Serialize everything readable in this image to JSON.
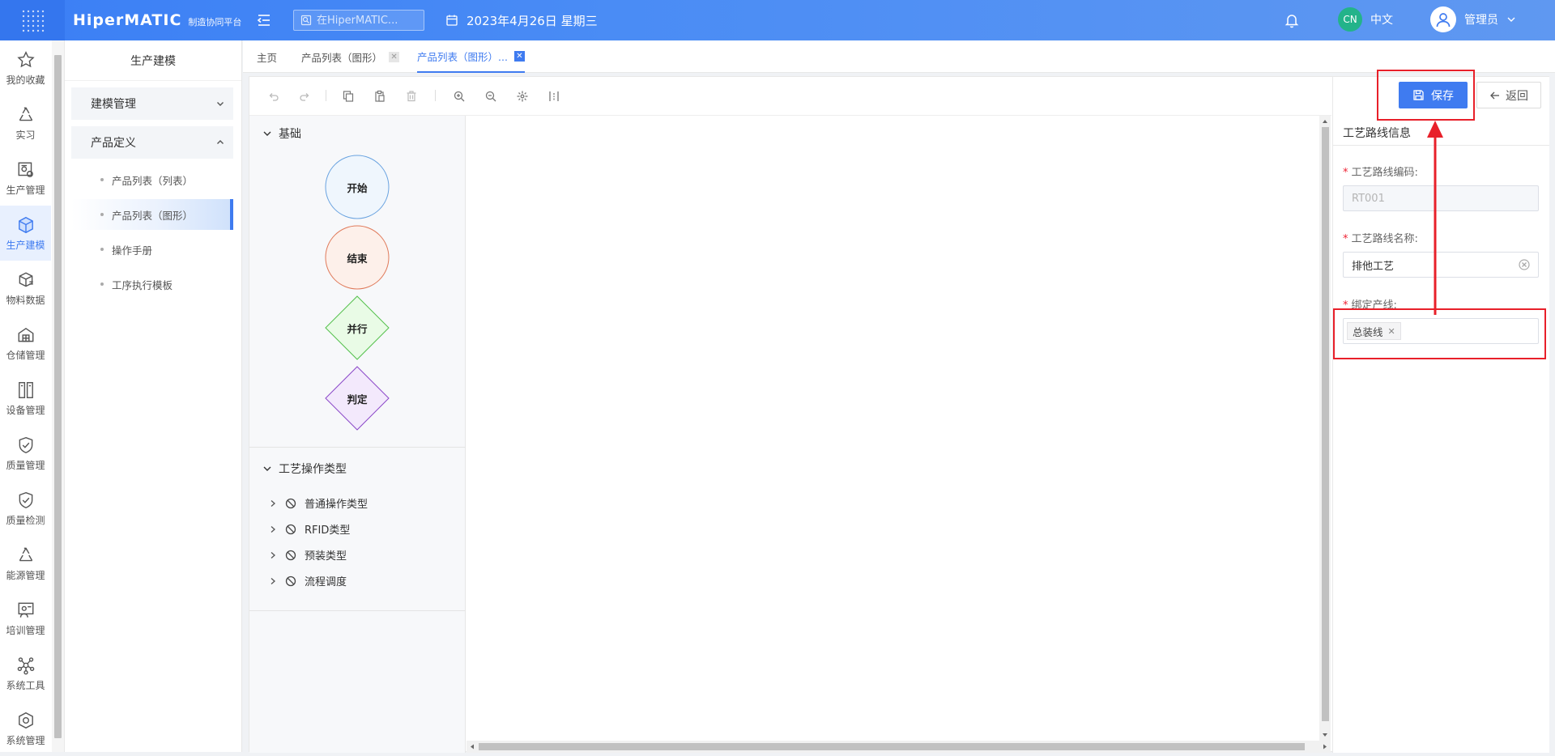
{
  "header": {
    "logo_main": "HiperMATIC",
    "logo_sub": "制造协同平台",
    "search_placeholder": "在HiperMATIC...",
    "date_text": "2023年4月26日 星期三",
    "lang_badge": "CN",
    "lang_label": "中文",
    "user_name": "管理员"
  },
  "rail": {
    "items": [
      {
        "label": "我的收藏",
        "icon": "star-icon"
      },
      {
        "label": "实习",
        "icon": "recycle-icon"
      },
      {
        "label": "生产管理",
        "icon": "production-icon"
      },
      {
        "label": "生产建模",
        "icon": "cube-icon"
      },
      {
        "label": "物料数据",
        "icon": "box-icon"
      },
      {
        "label": "仓储管理",
        "icon": "warehouse-icon"
      },
      {
        "label": "设备管理",
        "icon": "device-icon"
      },
      {
        "label": "质量管理",
        "icon": "shield-check-icon"
      },
      {
        "label": "质量检测",
        "icon": "shield-check-icon"
      },
      {
        "label": "能源管理",
        "icon": "recycle-icon"
      },
      {
        "label": "培训管理",
        "icon": "training-icon"
      },
      {
        "label": "系统工具",
        "icon": "network-icon"
      },
      {
        "label": "系统管理",
        "icon": "settings-cube-icon"
      }
    ],
    "active_index": 3
  },
  "submenu": {
    "title": "生产建模",
    "group_modeling": "建模管理",
    "group_product": "产品定义",
    "items": [
      "产品列表（列表）",
      "产品列表（图形）",
      "操作手册",
      "工序执行模板"
    ]
  },
  "tabs": {
    "home": "主页",
    "tab1": "产品列表（图形）",
    "tab2": "产品列表（图形）..."
  },
  "palette": {
    "basic_title": "基础",
    "nodes": {
      "start": "开始",
      "end": "结束",
      "parallel": "并行",
      "decision": "判定"
    },
    "ops_title": "工艺操作类型",
    "ops": [
      "普通操作类型",
      "RFID类型",
      "预装类型",
      "流程调度"
    ]
  },
  "panel": {
    "save_label": "保存",
    "back_label": "返回",
    "title": "工艺路线信息",
    "code_label": "工艺路线编码:",
    "code_value": "RT001",
    "name_label": "工艺路线名称:",
    "name_value": "排他工艺",
    "line_label": "绑定产线:",
    "line_tag": "总装线"
  },
  "colors": {
    "accent": "#3f7bf0",
    "highlight": "#e8202a"
  }
}
